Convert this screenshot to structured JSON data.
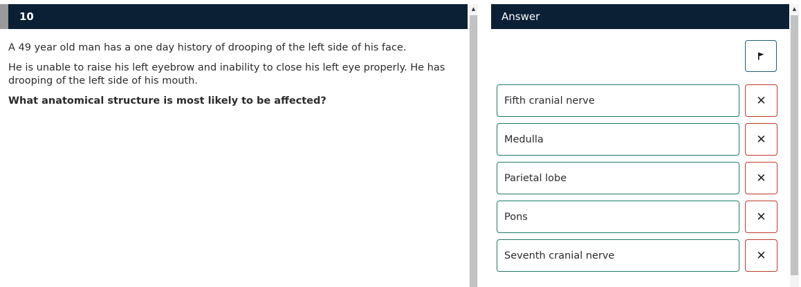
{
  "question": {
    "number": "10",
    "stem_line1": "A 49 year old man has a one day history of drooping of the left side of his face.",
    "stem_line2": "He is unable to raise his left eyebrow and inability to close his left eye properly. He has drooping of the left side of his mouth.",
    "prompt": "What anatomical structure is most likely to be affected?"
  },
  "answer_panel": {
    "title": "Answer",
    "flag_icon": "flag-icon",
    "strike_glyph": "✕",
    "options": [
      {
        "label": "Fifth cranial nerve"
      },
      {
        "label": "Medulla"
      },
      {
        "label": "Parietal lobe"
      },
      {
        "label": "Pons"
      },
      {
        "label": "Seventh cranial nerve"
      }
    ]
  },
  "colors": {
    "header_bg": "#0b1f35",
    "option_border": "#1e7a67",
    "strike_border": "#c0392b",
    "flag_border": "#1d5c73"
  }
}
